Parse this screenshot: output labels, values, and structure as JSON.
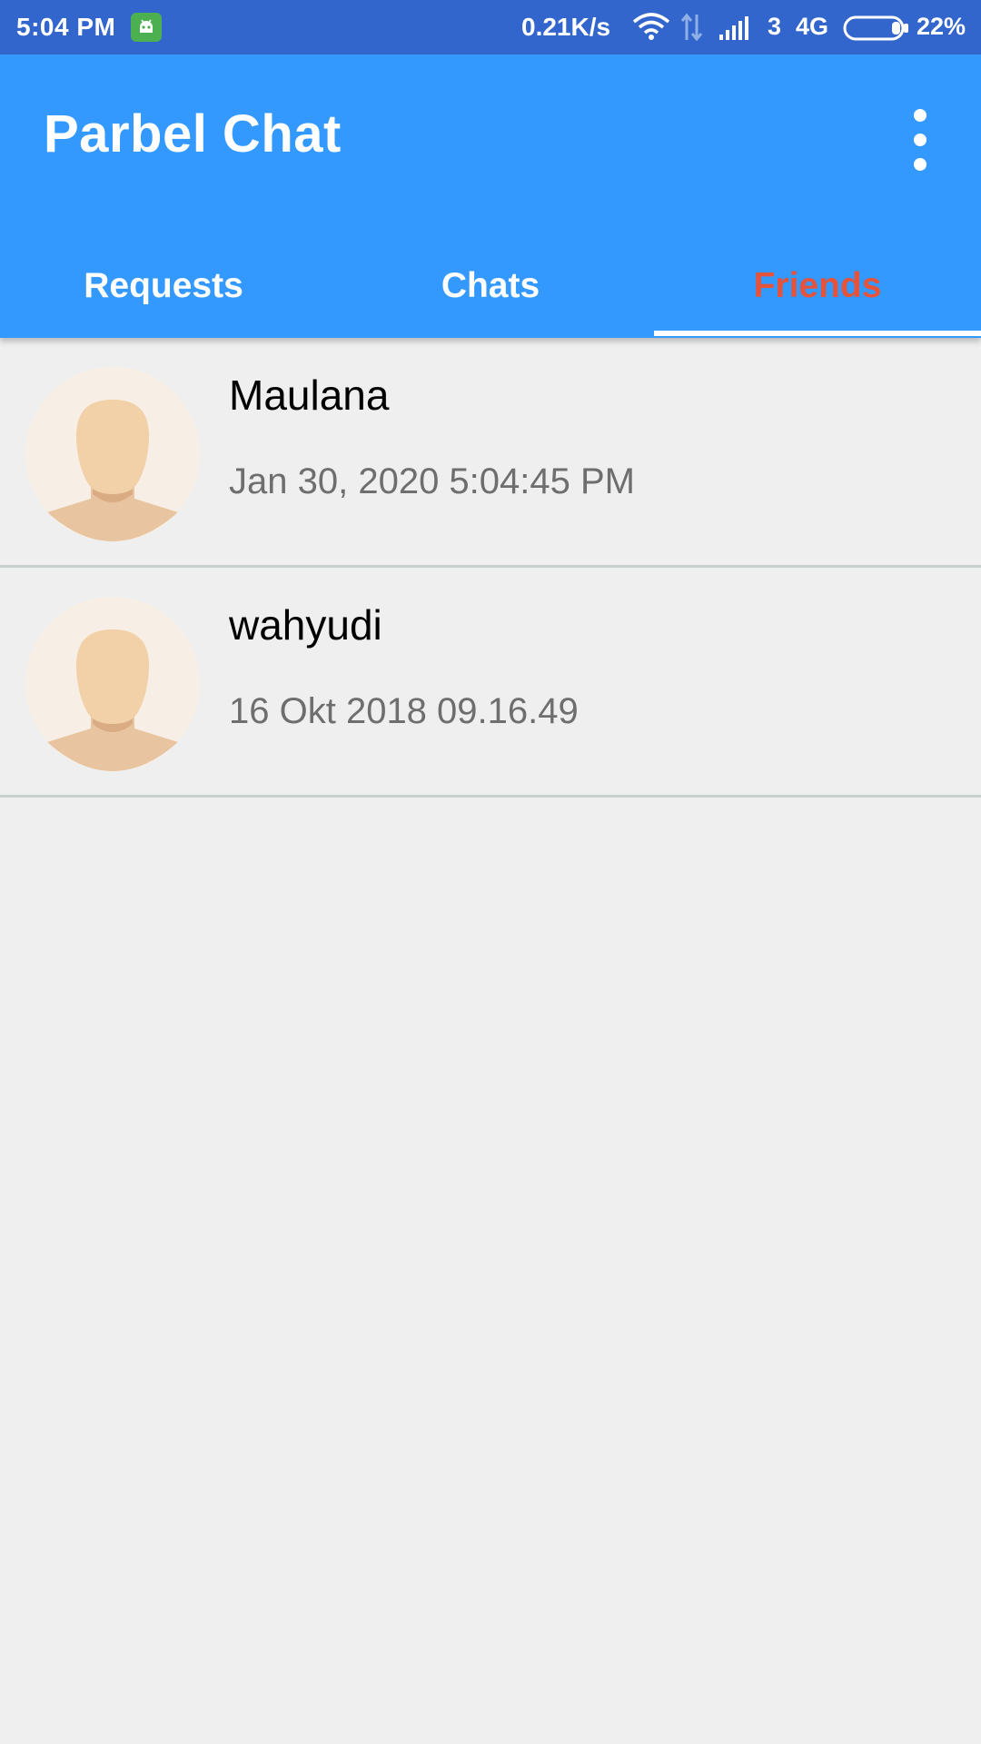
{
  "status_bar": {
    "time": "5:04 PM",
    "net_speed": "0.21K/s",
    "sim_slot": "3",
    "network_type": "4G",
    "battery_percent": "22%",
    "notification_icon": "android-robot-icon",
    "icons": [
      "wifi-icon",
      "data-arrows-icon",
      "signal-icon",
      "battery-icon"
    ]
  },
  "app_bar": {
    "title": "Parbel Chat",
    "menu_icon": "overflow-menu-icon"
  },
  "tabs": [
    {
      "label": "Requests",
      "active": false
    },
    {
      "label": "Chats",
      "active": false
    },
    {
      "label": "Friends",
      "active": true
    }
  ],
  "friends": [
    {
      "name": "Maulana",
      "timestamp": "Jan 30, 2020 5:04:45 PM",
      "avatar": "default-avatar-icon"
    },
    {
      "name": "wahyudi",
      "timestamp": "16 Okt 2018 09.16.49",
      "avatar": "default-avatar-icon"
    }
  ],
  "colors": {
    "status_bar": "#3366cc",
    "app_bar": "#3399ff",
    "active_tab": "#e5533a",
    "background": "#efefef",
    "timestamp_text": "#6e6e6e"
  }
}
